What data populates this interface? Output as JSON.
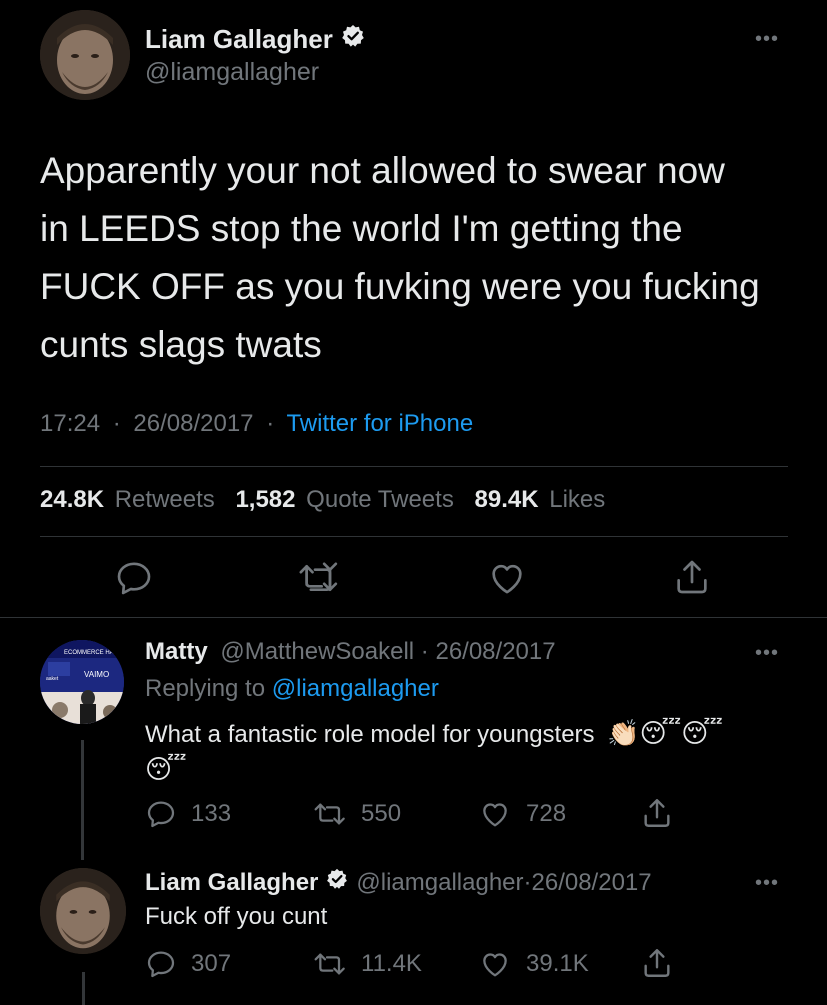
{
  "main_tweet": {
    "author_name": "Liam Gallagher",
    "handle": "@liamgallagher",
    "text_lines": [
      "Apparently your not allowed to swear now",
      "in LEEDS stop the world I'm getting the",
      "FUCK OFF as you fuvking were you fucking",
      "cunts slags twats"
    ],
    "time": "17:24",
    "date": "26/08/2017",
    "separator": "·",
    "source": "Twitter for iPhone",
    "stats": {
      "retweets_count": "24.8K",
      "retweets_label": "Retweets",
      "quotes_count": "1,582",
      "quotes_label": "Quote Tweets",
      "likes_count": "89.4K",
      "likes_label": "Likes"
    }
  },
  "reply_1": {
    "author_name": "Matty",
    "handle": "@MatthewSoakell",
    "separator": "·",
    "date": "26/08/2017",
    "replying_prefix": "Replying to",
    "replying_handle": "@liamgallagher",
    "text": "What a fantastic role model for youngsters",
    "emoji_inline": "👏🏻😴😴",
    "emoji_line2": "😴",
    "avatar_text_top": "ECOMMERCE HA",
    "avatar_text_logo": "VAIMO",
    "avatar_text_side": "aaket",
    "reply_count": "133",
    "retweet_count": "550",
    "like_count": "728"
  },
  "reply_2": {
    "author_name": "Liam Gallagher",
    "handle": "@liamgallagher",
    "separator": "·",
    "date": "26/08/2017",
    "text": "Fuck off you cunt",
    "reply_count": "307",
    "retweet_count": "11.4K",
    "like_count": "39.1K"
  },
  "more_glyph": "•••",
  "colors": {
    "background": "#000000",
    "text": "#e7e9ea",
    "muted": "#71767b",
    "link": "#1d9bf0",
    "divider": "#2f3336"
  }
}
